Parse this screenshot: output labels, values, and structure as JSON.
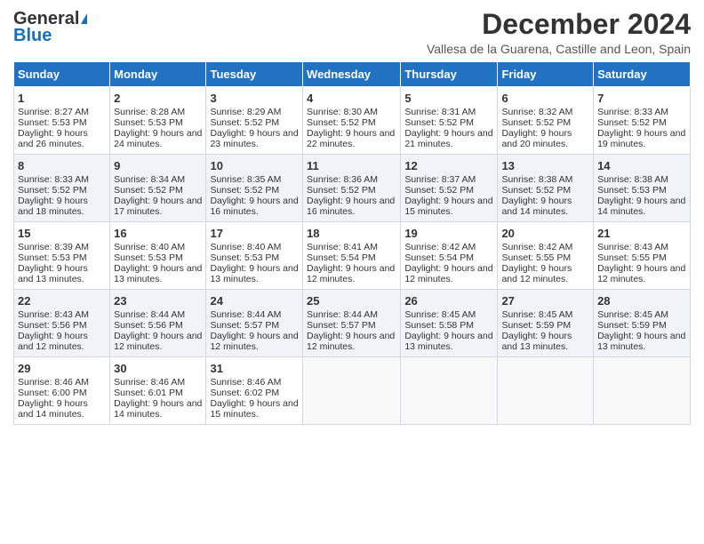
{
  "logo": {
    "general": "General",
    "blue": "Blue"
  },
  "title": "December 2024",
  "subtitle": "Vallesa de la Guarena, Castille and Leon, Spain",
  "headers": [
    "Sunday",
    "Monday",
    "Tuesday",
    "Wednesday",
    "Thursday",
    "Friday",
    "Saturday"
  ],
  "weeks": [
    [
      {
        "day": "1",
        "sunrise": "Sunrise: 8:27 AM",
        "sunset": "Sunset: 5:53 PM",
        "daylight": "Daylight: 9 hours and 26 minutes."
      },
      {
        "day": "2",
        "sunrise": "Sunrise: 8:28 AM",
        "sunset": "Sunset: 5:53 PM",
        "daylight": "Daylight: 9 hours and 24 minutes."
      },
      {
        "day": "3",
        "sunrise": "Sunrise: 8:29 AM",
        "sunset": "Sunset: 5:52 PM",
        "daylight": "Daylight: 9 hours and 23 minutes."
      },
      {
        "day": "4",
        "sunrise": "Sunrise: 8:30 AM",
        "sunset": "Sunset: 5:52 PM",
        "daylight": "Daylight: 9 hours and 22 minutes."
      },
      {
        "day": "5",
        "sunrise": "Sunrise: 8:31 AM",
        "sunset": "Sunset: 5:52 PM",
        "daylight": "Daylight: 9 hours and 21 minutes."
      },
      {
        "day": "6",
        "sunrise": "Sunrise: 8:32 AM",
        "sunset": "Sunset: 5:52 PM",
        "daylight": "Daylight: 9 hours and 20 minutes."
      },
      {
        "day": "7",
        "sunrise": "Sunrise: 8:33 AM",
        "sunset": "Sunset: 5:52 PM",
        "daylight": "Daylight: 9 hours and 19 minutes."
      }
    ],
    [
      {
        "day": "8",
        "sunrise": "Sunrise: 8:33 AM",
        "sunset": "Sunset: 5:52 PM",
        "daylight": "Daylight: 9 hours and 18 minutes."
      },
      {
        "day": "9",
        "sunrise": "Sunrise: 8:34 AM",
        "sunset": "Sunset: 5:52 PM",
        "daylight": "Daylight: 9 hours and 17 minutes."
      },
      {
        "day": "10",
        "sunrise": "Sunrise: 8:35 AM",
        "sunset": "Sunset: 5:52 PM",
        "daylight": "Daylight: 9 hours and 16 minutes."
      },
      {
        "day": "11",
        "sunrise": "Sunrise: 8:36 AM",
        "sunset": "Sunset: 5:52 PM",
        "daylight": "Daylight: 9 hours and 16 minutes."
      },
      {
        "day": "12",
        "sunrise": "Sunrise: 8:37 AM",
        "sunset": "Sunset: 5:52 PM",
        "daylight": "Daylight: 9 hours and 15 minutes."
      },
      {
        "day": "13",
        "sunrise": "Sunrise: 8:38 AM",
        "sunset": "Sunset: 5:52 PM",
        "daylight": "Daylight: 9 hours and 14 minutes."
      },
      {
        "day": "14",
        "sunrise": "Sunrise: 8:38 AM",
        "sunset": "Sunset: 5:53 PM",
        "daylight": "Daylight: 9 hours and 14 minutes."
      }
    ],
    [
      {
        "day": "15",
        "sunrise": "Sunrise: 8:39 AM",
        "sunset": "Sunset: 5:53 PM",
        "daylight": "Daylight: 9 hours and 13 minutes."
      },
      {
        "day": "16",
        "sunrise": "Sunrise: 8:40 AM",
        "sunset": "Sunset: 5:53 PM",
        "daylight": "Daylight: 9 hours and 13 minutes."
      },
      {
        "day": "17",
        "sunrise": "Sunrise: 8:40 AM",
        "sunset": "Sunset: 5:53 PM",
        "daylight": "Daylight: 9 hours and 13 minutes."
      },
      {
        "day": "18",
        "sunrise": "Sunrise: 8:41 AM",
        "sunset": "Sunset: 5:54 PM",
        "daylight": "Daylight: 9 hours and 12 minutes."
      },
      {
        "day": "19",
        "sunrise": "Sunrise: 8:42 AM",
        "sunset": "Sunset: 5:54 PM",
        "daylight": "Daylight: 9 hours and 12 minutes."
      },
      {
        "day": "20",
        "sunrise": "Sunrise: 8:42 AM",
        "sunset": "Sunset: 5:55 PM",
        "daylight": "Daylight: 9 hours and 12 minutes."
      },
      {
        "day": "21",
        "sunrise": "Sunrise: 8:43 AM",
        "sunset": "Sunset: 5:55 PM",
        "daylight": "Daylight: 9 hours and 12 minutes."
      }
    ],
    [
      {
        "day": "22",
        "sunrise": "Sunrise: 8:43 AM",
        "sunset": "Sunset: 5:56 PM",
        "daylight": "Daylight: 9 hours and 12 minutes."
      },
      {
        "day": "23",
        "sunrise": "Sunrise: 8:44 AM",
        "sunset": "Sunset: 5:56 PM",
        "daylight": "Daylight: 9 hours and 12 minutes."
      },
      {
        "day": "24",
        "sunrise": "Sunrise: 8:44 AM",
        "sunset": "Sunset: 5:57 PM",
        "daylight": "Daylight: 9 hours and 12 minutes."
      },
      {
        "day": "25",
        "sunrise": "Sunrise: 8:44 AM",
        "sunset": "Sunset: 5:57 PM",
        "daylight": "Daylight: 9 hours and 12 minutes."
      },
      {
        "day": "26",
        "sunrise": "Sunrise: 8:45 AM",
        "sunset": "Sunset: 5:58 PM",
        "daylight": "Daylight: 9 hours and 13 minutes."
      },
      {
        "day": "27",
        "sunrise": "Sunrise: 8:45 AM",
        "sunset": "Sunset: 5:59 PM",
        "daylight": "Daylight: 9 hours and 13 minutes."
      },
      {
        "day": "28",
        "sunrise": "Sunrise: 8:45 AM",
        "sunset": "Sunset: 5:59 PM",
        "daylight": "Daylight: 9 hours and 13 minutes."
      }
    ],
    [
      {
        "day": "29",
        "sunrise": "Sunrise: 8:46 AM",
        "sunset": "Sunset: 6:00 PM",
        "daylight": "Daylight: 9 hours and 14 minutes."
      },
      {
        "day": "30",
        "sunrise": "Sunrise: 8:46 AM",
        "sunset": "Sunset: 6:01 PM",
        "daylight": "Daylight: 9 hours and 14 minutes."
      },
      {
        "day": "31",
        "sunrise": "Sunrise: 8:46 AM",
        "sunset": "Sunset: 6:02 PM",
        "daylight": "Daylight: 9 hours and 15 minutes."
      },
      null,
      null,
      null,
      null
    ]
  ]
}
